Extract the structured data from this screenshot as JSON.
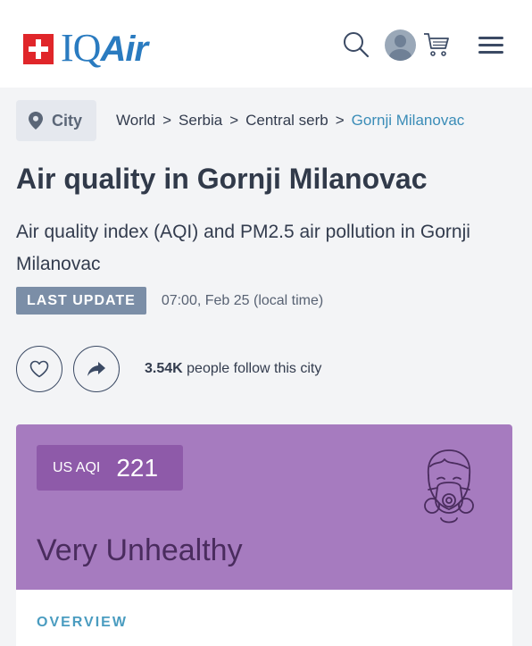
{
  "header": {
    "logo_text_iq": "IQ",
    "logo_text_air": "Air",
    "icons": [
      "swiss-flag-icon",
      "search-icon",
      "avatar",
      "cart-icon",
      "menu-icon"
    ]
  },
  "breadcrumb": {
    "chip_label": "City",
    "items": [
      "World",
      "Serbia",
      "Central serb",
      "Gornji Milanovac"
    ],
    "separator": ">"
  },
  "page": {
    "title": "Air quality in Gornji Milanovac",
    "subtitle": "Air quality index (AQI) and PM2.5 air pollution in Gornji Milanovac",
    "update_badge": "LAST UPDATE",
    "update_time": "07:00, Feb 25 (local time)"
  },
  "follow": {
    "count": "3.54K",
    "text": "people follow this city"
  },
  "aqi": {
    "label": "US AQI",
    "value": "221",
    "status": "Very Unhealthy",
    "card_color": "#a67bbf",
    "value_box_color": "#8e5aa9",
    "status_text_color": "#4a2c5e"
  },
  "overview": {
    "label": "OVERVIEW"
  },
  "colors": {
    "brand": "#2a7bc0",
    "link": "#3a8cb7",
    "badge": "#7b8ea7"
  }
}
